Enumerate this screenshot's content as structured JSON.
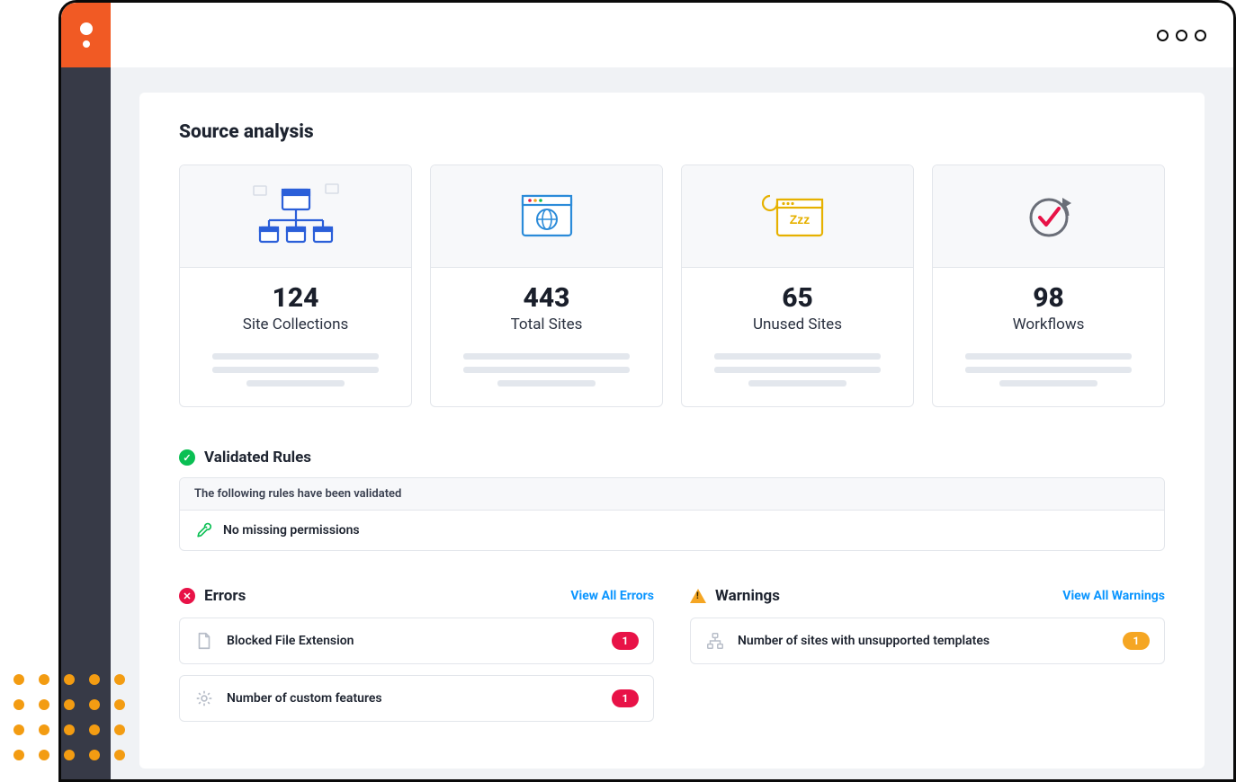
{
  "page": {
    "title": "Source analysis"
  },
  "stats": [
    {
      "value": "124",
      "label": "Site Collections"
    },
    {
      "value": "443",
      "label": "Total Sites"
    },
    {
      "value": "65",
      "label": "Unused Sites"
    },
    {
      "value": "98",
      "label": "Workflows"
    }
  ],
  "validated": {
    "title": "Validated Rules",
    "subheader": "The following rules have been validated",
    "rule": "No missing permissions"
  },
  "errors": {
    "title": "Errors",
    "view_all": "View All Errors",
    "items": [
      {
        "label": "Blocked File Extension",
        "count": "1"
      },
      {
        "label": "Number of custom features",
        "count": "1"
      }
    ]
  },
  "warnings": {
    "title": "Warnings",
    "view_all": "View All Warnings",
    "items": [
      {
        "label": "Number of sites with unsupported templates",
        "count": "1"
      }
    ]
  }
}
